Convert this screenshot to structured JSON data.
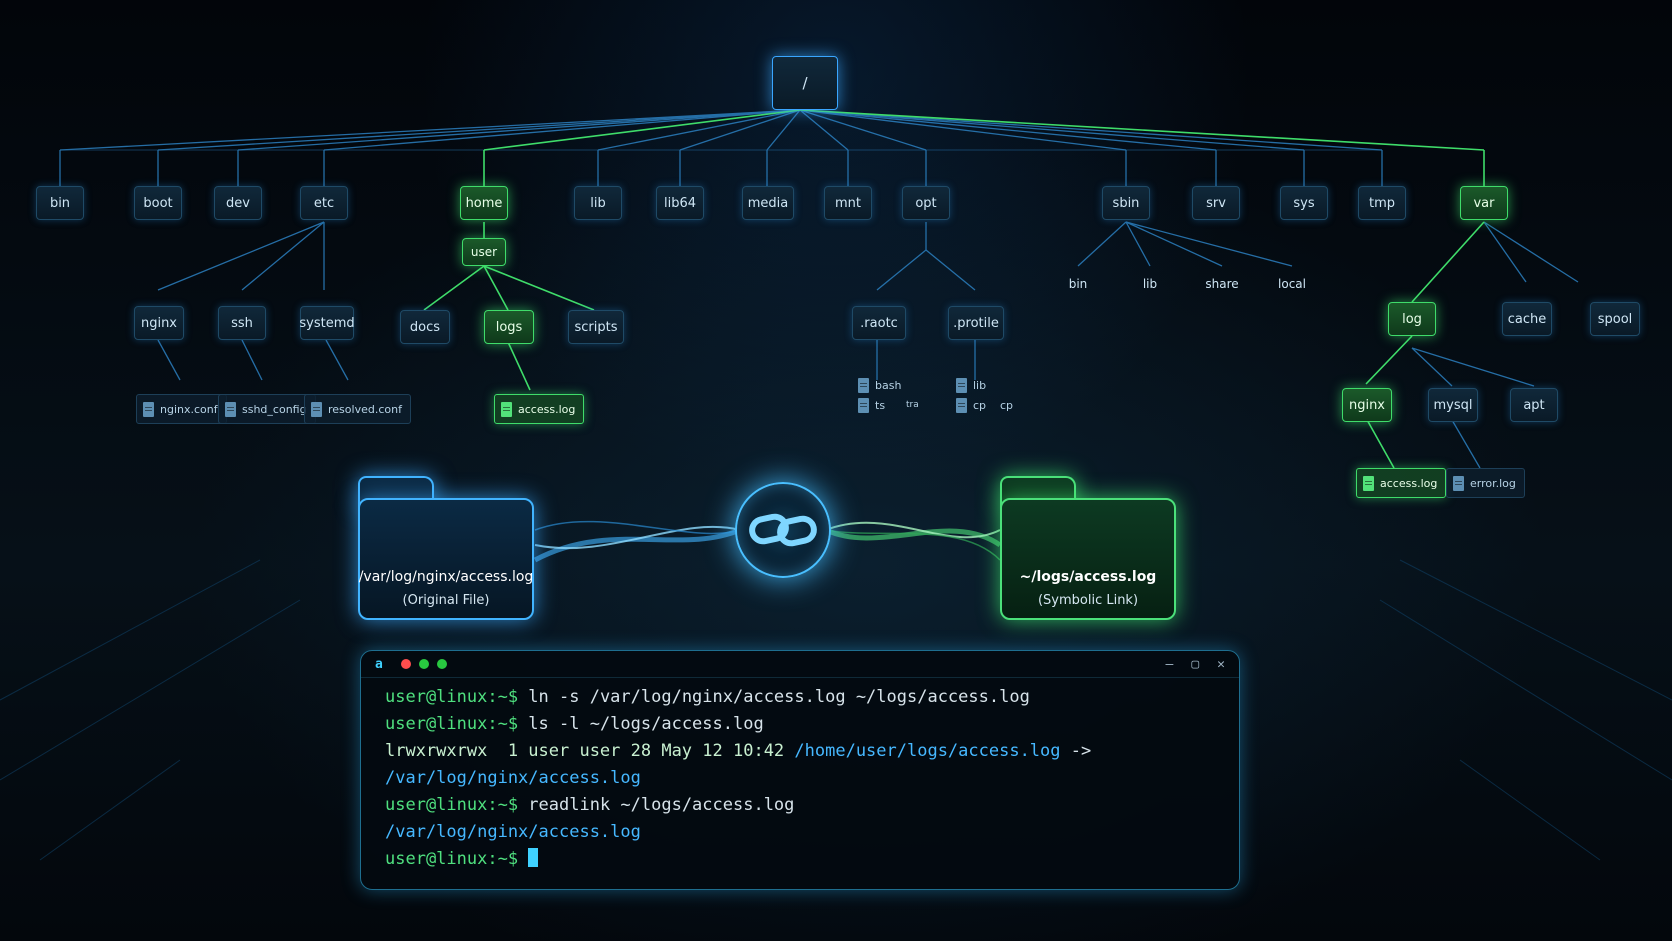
{
  "root": "/",
  "top_dirs": [
    "bin",
    "boot",
    "dev",
    "etc",
    "home",
    "lib",
    "lib64",
    "media",
    "mnt",
    "opt",
    "sbin",
    "srv",
    "sys",
    "tmp",
    "var"
  ],
  "etc_children": [
    "nginx",
    "ssh",
    "systemd"
  ],
  "etc_files": [
    "nginx.conf",
    "sshd_config",
    "resolved.conf"
  ],
  "home_child": "user",
  "user_children": [
    "docs",
    "logs",
    "scripts"
  ],
  "logs_file": "access.log",
  "opt_children": [
    ".raotc",
    ".protile"
  ],
  "opt_files": [
    "bash",
    "ts",
    "tra",
    "lib",
    "cp",
    "cp"
  ],
  "sbin_children": [
    "bin",
    "lib",
    "share",
    "local"
  ],
  "var_children": [
    "log",
    "cache",
    "spool"
  ],
  "log_children": [
    "nginx",
    "mysql",
    "apt"
  ],
  "var_files": [
    "access.log",
    "error.log"
  ],
  "original": {
    "path": "/var/log/nginx/access.log",
    "caption": "(Original File)"
  },
  "symlink": {
    "path": "~/logs/access.log",
    "caption": "(Symbolic Link)"
  },
  "colors": {
    "blue": "#41b4ff",
    "green": "#4be07a",
    "background": "#03070c"
  },
  "terminal": {
    "logo": "a",
    "window_controls": [
      "–",
      "▢",
      "✕"
    ],
    "l1_prompt": "user@linux:~$",
    "l1_cmd": " ln -s /var/log/nginx/access.log ~/logs/access.log",
    "l2_prompt": "user@linux:~$",
    "l2_cmd": " ls -l ~/logs/access.log",
    "l3_perm": "lrwxrwxrwx  1 user user 28 May 12 10:42 ",
    "l3_path": "/home/user/logs/access.log",
    "l3_arrow": " ->",
    "l4_target": "/var/log/nginx/access.log",
    "l5_prompt": "user@linux:~$",
    "l5_cmd": " readlink ~/logs/access.log",
    "l6_output": "/var/log/nginx/access.log",
    "l7_prompt": "user@linux:~$"
  }
}
